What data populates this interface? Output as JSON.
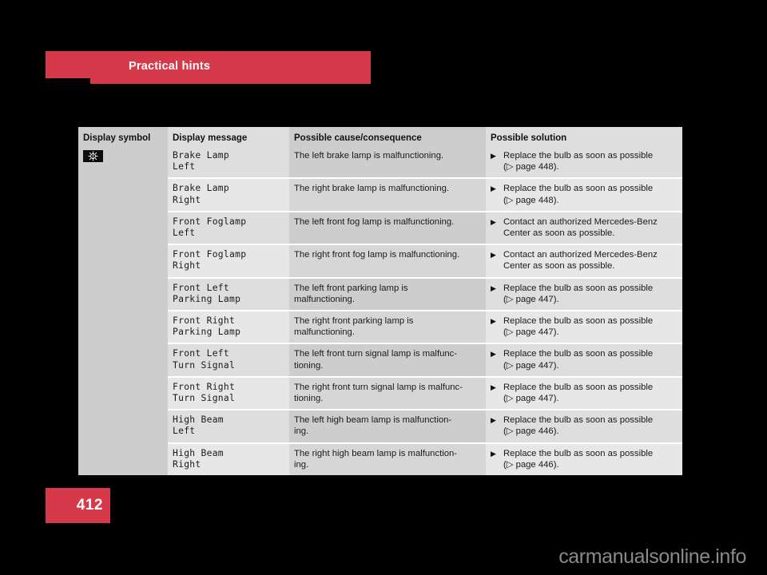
{
  "banner": {
    "title": "Practical hints",
    "color": "#d6394a"
  },
  "page": {
    "number": "412",
    "watermark": "carmanualsonline.info"
  },
  "table": {
    "headers": {
      "symbol": "Display symbol",
      "message": "Display message",
      "cause": "Possible cause/consequence",
      "solution": "Possible solution"
    },
    "symbol_icon": "lamp-bulb-warning-icon",
    "bullet": "▶",
    "ref_arrow": "▷",
    "rows": [
      {
        "message": "Brake Lamp\nLeft",
        "cause": "The left brake lamp is malfunctioning.",
        "solution": "Replace the bulb as soon as possible\n(▷ page 448)."
      },
      {
        "message": "Brake Lamp\nRight",
        "cause": "The right brake lamp is malfunctioning.",
        "solution": "Replace the bulb as soon as possible\n(▷ page 448)."
      },
      {
        "message": "Front Foglamp\nLeft",
        "cause": "The left front fog lamp is malfunctioning.",
        "solution": "Contact an authorized Mercedes-Benz\nCenter as soon as possible."
      },
      {
        "message": "Front Foglamp\nRight",
        "cause": "The right front fog lamp is malfunctioning.",
        "solution": "Contact an authorized Mercedes-Benz\nCenter as soon as possible."
      },
      {
        "message": "Front Left\nParking Lamp",
        "cause": "The left front parking lamp is\nmalfunctioning.",
        "solution": "Replace the bulb as soon as possible\n(▷ page 447)."
      },
      {
        "message": "Front Right\nParking Lamp",
        "cause": "The right front parking lamp is\nmalfunctioning.",
        "solution": "Replace the bulb as soon as possible\n(▷ page 447)."
      },
      {
        "message": "Front Left\nTurn Signal",
        "cause": "The left front turn signal lamp is malfunc-\ntioning.",
        "solution": "Replace the bulb as soon as possible\n(▷ page 447)."
      },
      {
        "message": "Front Right\nTurn Signal",
        "cause": "The right front turn signal lamp is malfunc-\ntioning.",
        "solution": "Replace the bulb as soon as possible\n(▷ page 447)."
      },
      {
        "message": "High Beam\nLeft",
        "cause": "The left high beam lamp is malfunction-\ning.",
        "solution": "Replace the bulb as soon as possible\n(▷ page 446)."
      },
      {
        "message": "High Beam\nRight",
        "cause": "The right high beam lamp is malfunction-\ning.",
        "solution": "Replace the bulb as soon as possible\n(▷ page 446)."
      }
    ]
  }
}
